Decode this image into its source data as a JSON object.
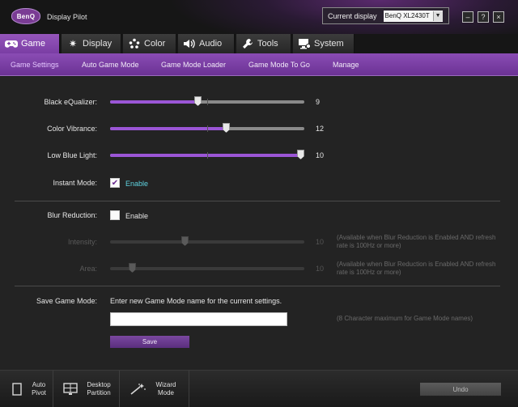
{
  "header": {
    "logo": "BenQ",
    "app_title": "Display Pilot",
    "current_display_label": "Current display",
    "current_display_value": "BenQ XL2430T",
    "minimize": "–",
    "help": "?",
    "close": "×"
  },
  "tabs": [
    {
      "label": "Game",
      "icon": "gamepad-icon"
    },
    {
      "label": "Display",
      "icon": "brightness-icon"
    },
    {
      "label": "Color",
      "icon": "palette-icon"
    },
    {
      "label": "Audio",
      "icon": "speaker-icon"
    },
    {
      "label": "Tools",
      "icon": "wrench-icon"
    },
    {
      "label": "System",
      "icon": "monitor-gear-icon"
    }
  ],
  "subtabs": [
    "Game Settings",
    "Auto Game Mode",
    "Game Mode Loader",
    "Game Mode To Go",
    "Manage"
  ],
  "settings": {
    "black_equalizer": {
      "label": "Black eQualizer:",
      "value": "9",
      "level": 0.45
    },
    "color_vibrance": {
      "label": "Color Vibrance:",
      "value": "12",
      "level": 0.6
    },
    "low_blue_light": {
      "label": "Low Blue Light:",
      "value": "10",
      "level": 1.0
    },
    "instant_mode": {
      "label": "Instant Mode:",
      "checkbox_label": "Enable",
      "checked": true
    },
    "blur_reduction": {
      "label": "Blur Reduction:",
      "checkbox_label": "Enable",
      "checked": false
    },
    "intensity": {
      "label": "Intensity:",
      "value": "10",
      "level": 0.38,
      "note": "(Available when Blur Reduction is Enabled AND refresh rate is 100Hz or more)"
    },
    "area": {
      "label": "Area:",
      "value": "10",
      "level": 0.1,
      "note": "(Available when Blur Reduction is Enabled AND refresh rate is 100Hz or more)"
    },
    "save_game_mode": {
      "label": "Save Game Mode:",
      "instruction": "Enter new Game Mode name for the current settings.",
      "input_value": "",
      "note": "(8 Character maximum for Game Mode names)",
      "save_label": "Save"
    }
  },
  "footer": {
    "auto_pivot": "Auto Pivot",
    "desktop_partition": "Desktop Partition",
    "wizard_mode": "Wizard Mode",
    "undo": "Undo"
  },
  "colors": {
    "accent": "#9b56d6",
    "tab_active": "#8a4cb4"
  }
}
